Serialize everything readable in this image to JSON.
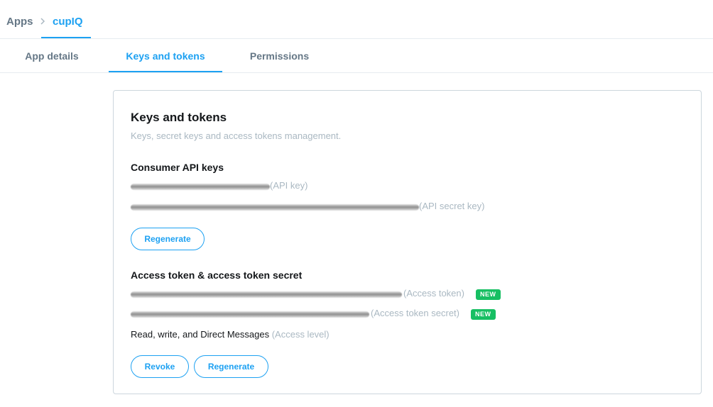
{
  "breadcrumb": {
    "root": "Apps",
    "current": "cupIQ"
  },
  "tabs": [
    {
      "label": "App details"
    },
    {
      "label": "Keys and tokens",
      "active": true
    },
    {
      "label": "Permissions"
    }
  ],
  "card": {
    "title": "Keys and tokens",
    "subtitle": "Keys, secret keys and access tokens management.",
    "consumer": {
      "title": "Consumer API keys",
      "api_key_label": "(API key)",
      "api_secret_label": "(API secret key)",
      "regenerate_label": "Regenerate"
    },
    "access": {
      "title": "Access token & access token secret",
      "token_label": "(Access token)",
      "secret_label": "(Access token secret)",
      "badge": "NEW",
      "level_value": "Read, write, and Direct Messages",
      "level_label": "(Access level)",
      "revoke_label": "Revoke",
      "regenerate_label": "Regenerate"
    }
  },
  "colors": {
    "accent": "#1da1f2",
    "new_badge": "#17bf63",
    "muted": "#aab8c2",
    "text": "#14171a",
    "tab_text": "#657786"
  },
  "icons": {
    "breadcrumb_separator": "chevron-right-icon"
  }
}
